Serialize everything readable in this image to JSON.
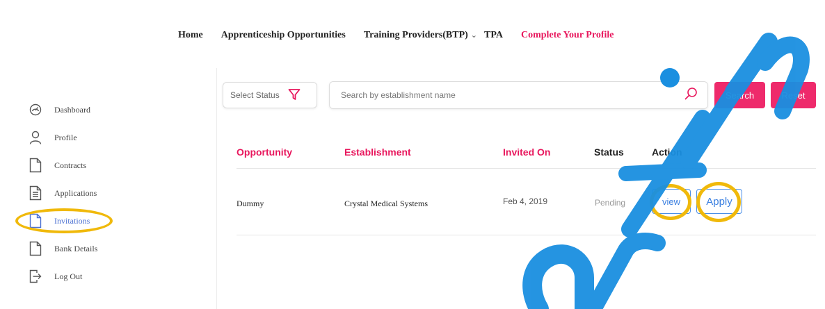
{
  "topnav": {
    "home": "Home",
    "apprenticeship": "Apprenticeship Opportunities",
    "training_providers": "Training Providers(BTP)",
    "tpa": "TPA",
    "complete_profile": "Complete Your Profile"
  },
  "sidebar": {
    "items": [
      {
        "label": "Dashboard",
        "icon": "dashboard-gauge-icon"
      },
      {
        "label": "Profile",
        "icon": "user-icon"
      },
      {
        "label": "Contracts",
        "icon": "document-icon"
      },
      {
        "label": "Applications",
        "icon": "document-lines-icon"
      },
      {
        "label": "Invitations",
        "icon": "document-icon",
        "active": true
      },
      {
        "label": "Bank Details",
        "icon": "document-icon"
      },
      {
        "label": "Log Out",
        "icon": "logout-icon"
      }
    ]
  },
  "filters": {
    "status_label": "Select Status",
    "search_placeholder": "Search by establishment name",
    "search_button": "Search",
    "reset_button": "Reset"
  },
  "table": {
    "headers": [
      "Opportunity",
      "Establishment",
      "Invited On",
      "Status",
      "Action"
    ],
    "rows": [
      {
        "opportunity": "Dummy",
        "establishment": "Crystal Medical Systems",
        "invited_on": "Feb 4, 2019",
        "status": "Pending",
        "view_label": "view",
        "apply_label": "Apply"
      }
    ]
  },
  "colors": {
    "accent": "#e8175d",
    "button_pink": "#ee2a6b",
    "link_blue": "#3a7fe0",
    "highlight": "#f0b90b",
    "watermark": "#1a8fe0"
  }
}
